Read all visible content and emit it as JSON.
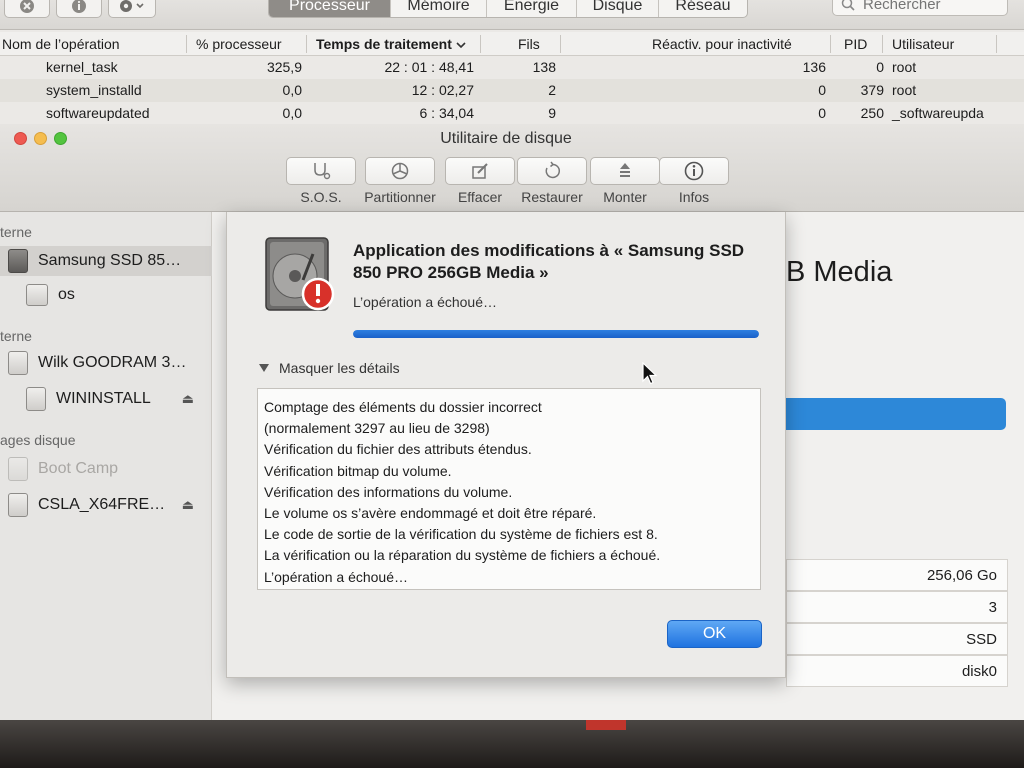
{
  "activity_monitor": {
    "tabs": [
      {
        "label": "Processeur",
        "active": true
      },
      {
        "label": "Mémoire",
        "active": false
      },
      {
        "label": "Énergie",
        "active": false
      },
      {
        "label": "Disque",
        "active": false
      },
      {
        "label": "Réseau",
        "active": false
      }
    ],
    "search_placeholder": "Rechercher",
    "columns": {
      "name": "Nom de l’opération",
      "cpu": "% processeur",
      "time": "Temps de traitement",
      "threads": "Fils",
      "idle_wakeups": "Réactiv. pour inactivité",
      "pid": "PID",
      "user": "Utilisateur"
    },
    "rows": [
      {
        "name": "kernel_task",
        "cpu": "325,9",
        "time": "22 : 01 : 48,41",
        "threads": "138",
        "idle_wakeups": "136",
        "pid": "0",
        "user": "root"
      },
      {
        "name": "system_installd",
        "cpu": "0,0",
        "time": "12 : 02,27",
        "threads": "2",
        "idle_wakeups": "0",
        "pid": "379",
        "user": "root"
      },
      {
        "name": "softwareupdated",
        "cpu": "0,0",
        "time": "6 : 34,04",
        "threads": "9",
        "idle_wakeups": "0",
        "pid": "250",
        "user": "_softwareupda"
      }
    ]
  },
  "disk_utility": {
    "title": "Utilitaire de disque",
    "toolbar": [
      {
        "label": "S.O.S.",
        "icon": "stethoscope-icon"
      },
      {
        "label": "Partitionner",
        "icon": "partition-icon"
      },
      {
        "label": "Effacer",
        "icon": "erase-icon"
      },
      {
        "label": "Restaurer",
        "icon": "restore-icon"
      },
      {
        "label": "Monter",
        "icon": "mount-icon"
      },
      {
        "label": "Infos",
        "icon": "info-icon"
      }
    ],
    "sidebar": {
      "section_internal": "terne",
      "section_external": "terne",
      "section_images": "ages disque",
      "items": [
        {
          "label": "Samsung SSD 85…",
          "selected": true
        },
        {
          "label": "os",
          "selected": false
        },
        {
          "label": "Wilk GOODRAM 3…",
          "selected": false
        },
        {
          "label": "WININSTALL",
          "selected": false
        },
        {
          "label": "Boot Camp",
          "selected": false
        },
        {
          "label": "CSLA_X64FRE…",
          "selected": false
        }
      ]
    },
    "main": {
      "title_fragment": "B Media",
      "info_values": [
        "256,06 Go",
        "3",
        "SSD",
        "disk0"
      ]
    },
    "dialog": {
      "title": "Application des modifications à « Samsung SSD 850 PRO 256GB Media »",
      "status": "L’opération a échoué…",
      "progress": 1.0,
      "details_toggle": "Masquer les détails",
      "log_lines": [
        "Comptage des éléments du dossier incorrect",
        "(normalement 3297 au lieu de 3298)",
        "Vérification du fichier des attributs étendus.",
        "Vérification bitmap du volume.",
        "Vérification des informations du volume.",
        "Le volume os s’avère endommagé et doit être réparé.",
        "Le code de sortie de la vérification du système de fichiers est 8.",
        "La vérification ou la réparation du système de fichiers a échoué.",
        "L’opération a échoué…"
      ],
      "ok_label": "OK"
    }
  },
  "colors": {
    "accent_blue": "#2d88d8",
    "progress_blue": "#1a60c8",
    "error_red": "#d8312a",
    "traffic_close": "#ee5a52",
    "traffic_minimize": "#f5bd4f",
    "traffic_zoom": "#53c43f"
  }
}
